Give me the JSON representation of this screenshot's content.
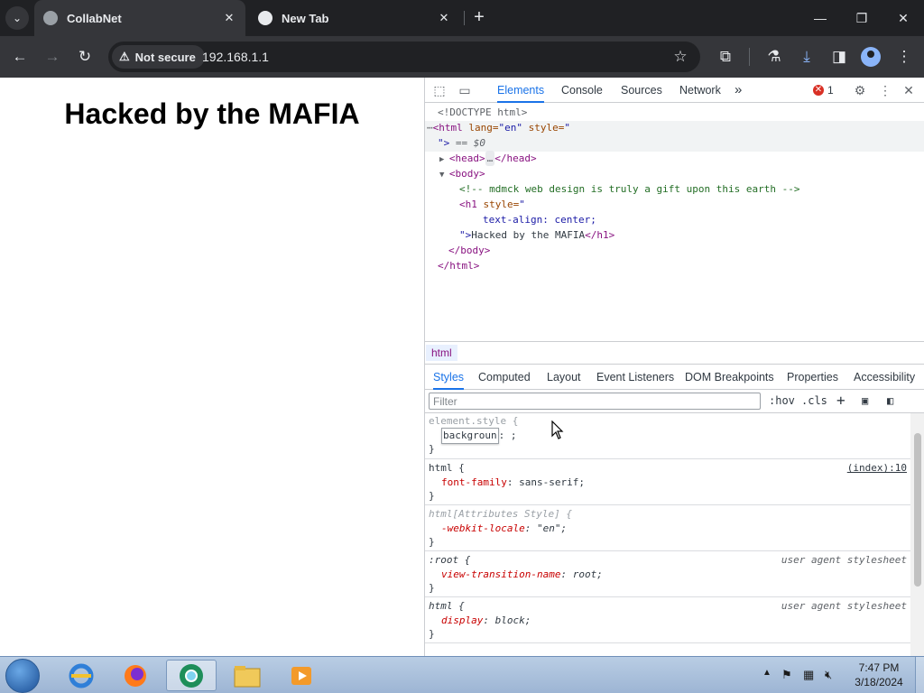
{
  "browser": {
    "tabs": [
      {
        "title": "CollabNet",
        "active": true
      },
      {
        "title": "New Tab",
        "active": false
      }
    ],
    "security_label": "Not secure",
    "url": "192.168.1.1"
  },
  "page": {
    "heading": "Hacked by the MAFIA"
  },
  "devtools": {
    "tabs": [
      "Elements",
      "Console",
      "Sources",
      "Network"
    ],
    "active_tab": "Elements",
    "more_tabs_glyph": "»",
    "error_count": "1",
    "dom": {
      "l1": "<!DOCTYPE html>",
      "l2_tag": "<html",
      "l2_attr1": " lang=",
      "l2_val1": "\"en\"",
      "l2_attr2": " style=",
      "l2_val2": "\"",
      "l3_tail": "\">",
      "l3_eq": " == $0",
      "l4_head_open": "<head>",
      "l4_ellipsis": "…",
      "l4_head_close": "</head>",
      "l5_body": "<body>",
      "l6_comment": "<!-- mdmck web design is truly a gift upon this earth -->",
      "l7_tag": "<h1",
      "l7_attr": " style=",
      "l7_val": "\"",
      "l8_css": "text-align: center;",
      "l9_q": "\">",
      "l9_text": "Hacked by the MAFIA",
      "l9_close": "</h1>",
      "l10": "</body>",
      "l11": "</html>"
    },
    "breadcrumb": "html",
    "style_tabs": [
      "Styles",
      "Computed",
      "Layout",
      "Event Listeners",
      "DOM Breakpoints",
      "Properties",
      "Accessibility"
    ],
    "active_style_tab": "Styles",
    "filter_placeholder": "Filter",
    "hov_label": ":hov",
    "cls_label": ".cls",
    "rules": {
      "r1_selector": "element.style {",
      "r1_editing": "backgroun",
      "r1_after": ": ;",
      "r2_selector": "html {",
      "r2_source": "(index):10",
      "r2_prop": "font-family",
      "r2_val": ": sans-serif;",
      "r3_selector": "html[Attributes Style] {",
      "r3_prop": "-webkit-locale",
      "r3_val": ": \"en\";",
      "r4_selector": ":root {",
      "r4_source": "user agent stylesheet",
      "r4_prop": "view-transition-name",
      "r4_val": ": root;",
      "r5_selector": "html {",
      "r5_source": "user agent stylesheet",
      "r5_prop": "display",
      "r5_val": ": block;",
      "close": "}"
    }
  },
  "taskbar": {
    "time": "7:47 PM",
    "date": "3/18/2024"
  }
}
